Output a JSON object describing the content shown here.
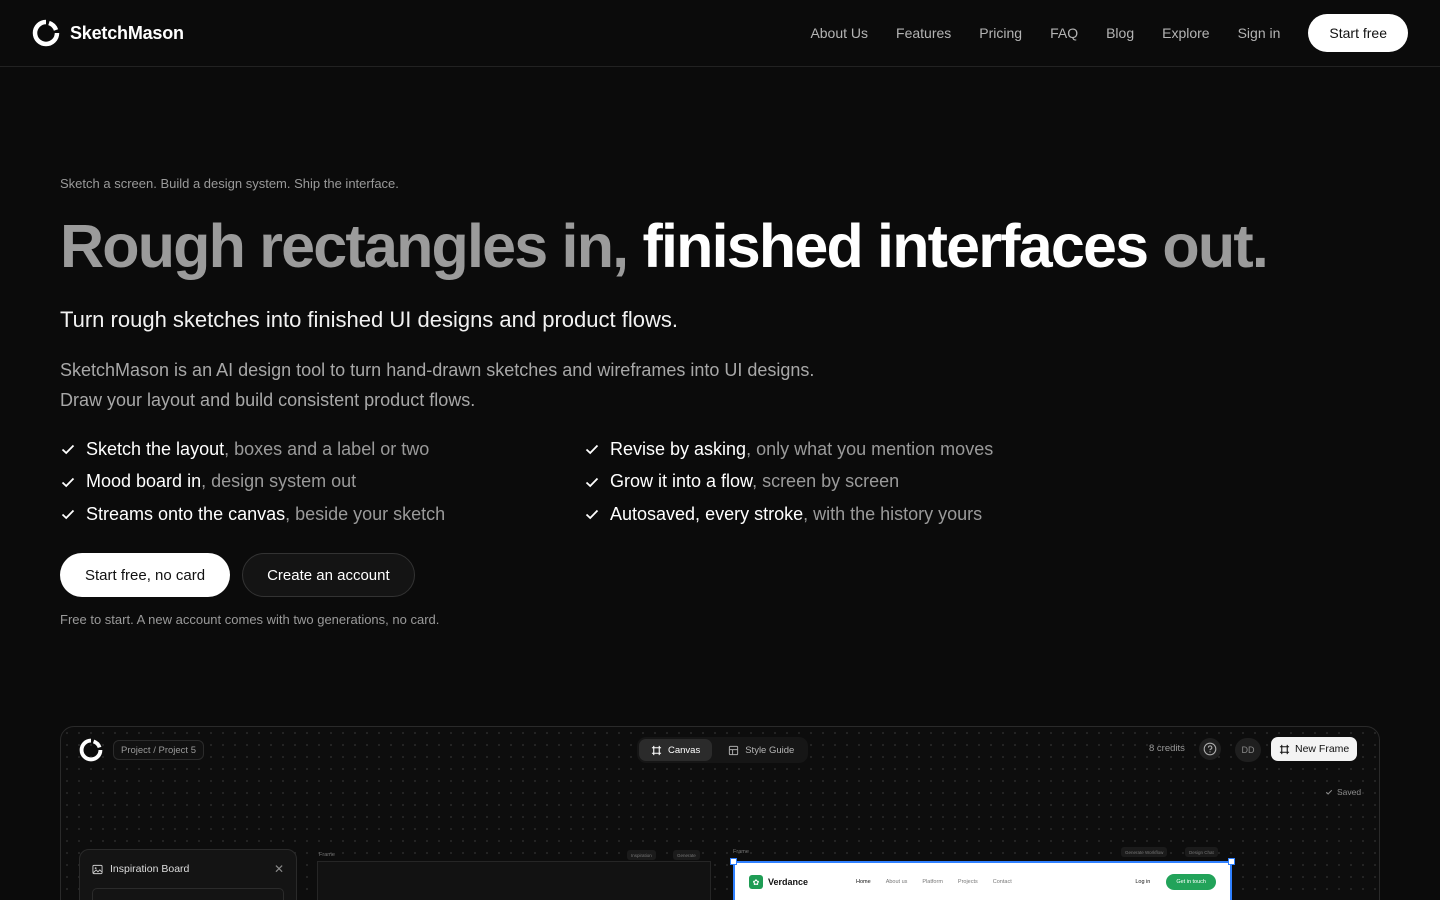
{
  "nav": {
    "brand": "SketchMason",
    "links": [
      "About Us",
      "Features",
      "Pricing",
      "FAQ",
      "Blog",
      "Explore",
      "Sign in"
    ],
    "cta": "Start free"
  },
  "hero": {
    "eyebrow": "Sketch a screen. Build a design system. Ship the interface.",
    "headline": {
      "part1": "Rough rectangles in,",
      "part2": "finished interfaces",
      "part3": "out."
    },
    "subhead": "Turn rough sketches into finished UI designs and product flows.",
    "description": "SketchMason is an AI design tool to turn hand-drawn sketches and wireframes into UI designs. Draw your layout and build consistent product flows.",
    "features": [
      {
        "strong": "Sketch the layout",
        "muted": ", boxes and a label or two"
      },
      {
        "strong": "Revise by asking",
        "muted": ", only what you mention moves"
      },
      {
        "strong": "Mood board in",
        "muted": ", design system out"
      },
      {
        "strong": "Grow it into a flow",
        "muted": ", screen by screen"
      },
      {
        "strong": "Streams onto the canvas",
        "muted": ", beside your sketch"
      },
      {
        "strong": "Autosaved, every stroke",
        "muted": ", with the history yours"
      }
    ],
    "primary_cta": "Start free, no card",
    "secondary_cta": "Create an account",
    "note": "Free to start. A new account comes with two generations, no card."
  },
  "preview": {
    "breadcrumb": "Project / Project 5",
    "tabs": [
      "Canvas",
      "Style Guide"
    ],
    "credits": "8 credits",
    "avatar": "DD",
    "new_frame": "New Frame",
    "saved": "Saved",
    "inspiration_title": "Inspiration Board",
    "frame_label": "Frame",
    "frame1_chips": [
      "Inspiration",
      "Generate"
    ],
    "frame2_chips": [
      "Generate Workflow",
      "Design Chat"
    ],
    "site": {
      "name": "Verdance",
      "links": [
        "Home",
        "About us",
        "Platform",
        "Projects",
        "Contact"
      ],
      "login": "Log in",
      "cta": "Get in touch"
    }
  },
  "colors": {
    "background": "#0b0b0b",
    "accent_green": "#22a35a",
    "selection_blue": "#2f80ff"
  }
}
